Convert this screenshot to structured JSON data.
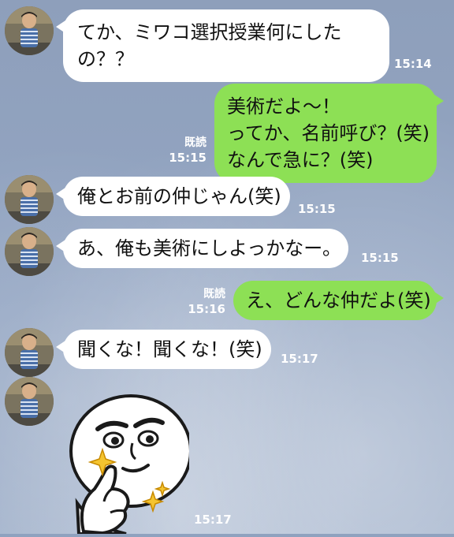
{
  "messages": [
    {
      "side": "in",
      "lines": [
        "てか、ミワコ選択授業何にした",
        "の？？"
      ],
      "time": "15:14"
    },
    {
      "side": "out",
      "lines": [
        "美術だよ〜！",
        "ってか、名前呼び？(笑)",
        "なんで急に？(笑)"
      ],
      "read": "既読",
      "time": "15:15"
    },
    {
      "side": "in",
      "lines": [
        "俺とお前の仲じゃん(笑)"
      ],
      "time": "15:15"
    },
    {
      "side": "in",
      "lines": [
        "あ、俺も美術にしよっかなー。"
      ],
      "time": "15:15"
    },
    {
      "side": "out",
      "lines": [
        "え、どんな仲だよ(笑)"
      ],
      "read": "既読",
      "time": "15:16"
    },
    {
      "side": "in",
      "lines": [
        "聞くな！聞くな！(笑)"
      ],
      "time": "15:17"
    },
    {
      "side": "in",
      "sticker": "smug-thumbs-up-face",
      "time": "15:17"
    }
  ],
  "colors": {
    "incoming_bubble": "#ffffff",
    "outgoing_bubble": "#8de055",
    "background": "#8fa2bf",
    "meta_text": "#ffffff"
  },
  "icons": {
    "avatar": "profile-photo-person-icon",
    "sticker": "smug-thumbs-up-face"
  }
}
